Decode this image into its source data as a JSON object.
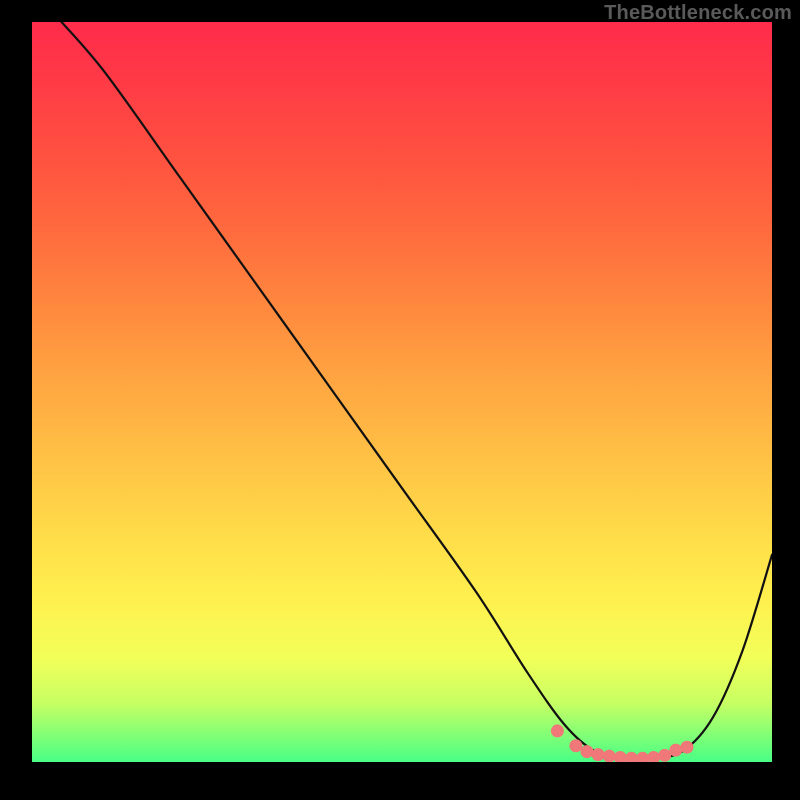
{
  "watermark": "TheBottleneck.com",
  "colors": {
    "frame": "#000000",
    "curve_stroke": "#111111",
    "marker_fill": "#f07878",
    "marker_stroke": "#d55a5a"
  },
  "chart_data": {
    "type": "line",
    "title": "",
    "xlabel": "",
    "ylabel": "",
    "xlim": [
      0,
      100
    ],
    "ylim": [
      0,
      100
    ],
    "grid": false,
    "series": [
      {
        "name": "bottleneck-curve",
        "x": [
          4,
          10,
          20,
          30,
          40,
          50,
          60,
          67,
          72,
          76,
          80,
          84,
          88,
          92,
          96,
          100
        ],
        "y": [
          100,
          93,
          79,
          65,
          51,
          37,
          23,
          12,
          5,
          1.5,
          0.5,
          0.5,
          1.5,
          6,
          15,
          28
        ]
      }
    ],
    "markers": {
      "name": "optimal-range",
      "x": [
        71,
        73.5,
        75,
        76.5,
        78,
        79.5,
        81,
        82.5,
        84,
        85.5,
        87,
        88.5
      ],
      "y": [
        4.2,
        2.2,
        1.4,
        1.0,
        0.8,
        0.6,
        0.5,
        0.5,
        0.6,
        0.9,
        1.6,
        2.0
      ]
    }
  }
}
